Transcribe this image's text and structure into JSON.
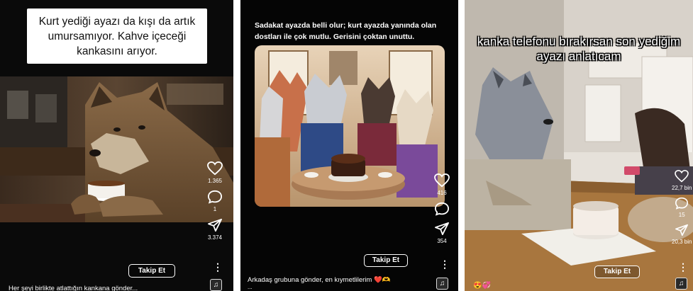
{
  "panel1": {
    "caption": "Kurt yediği ayazı da kışı da artık umursamıyor. Kahve içeceği kankasını arıyor.",
    "like_count": "1.365",
    "comment_count": "1",
    "share_count": "3.374",
    "follow_label": "Takip Et",
    "bottom_caption": "Her şeyi birlikte atlattığın kankana gönder...",
    "like_icon": "heart-icon",
    "comment_icon": "comment-bubble-icon",
    "share_icon": "paper-plane-icon",
    "more_icon": "more-dots-icon",
    "audio_icon": "music-note-icon"
  },
  "panel2": {
    "caption": "Sadakat ayazda belli olur; kurt ayazda yanında olan dostları ile çok mutlu. Gerisini çoktan unuttu.",
    "like_count": "416",
    "share_count": "354",
    "follow_label": "Takip Et",
    "bottom_caption": "Arkadaş grubuna gönder, en kıymetlilerim ❤️🫶",
    "bottom_caption_more": "..."
  },
  "panel3": {
    "overlay_text": "kanka telefonu bırakırsan son yediğim ayazı anlatıcam",
    "like_count": "22,7 bin",
    "comment_count": "15",
    "share_count": "20,3 bin",
    "follow_label": "Takip Et",
    "bottom_emojis": "😍💞"
  },
  "colors": {
    "dark_bg": "#0a0a0a",
    "text": "#ffffff",
    "heart_red": "#e0245e"
  }
}
